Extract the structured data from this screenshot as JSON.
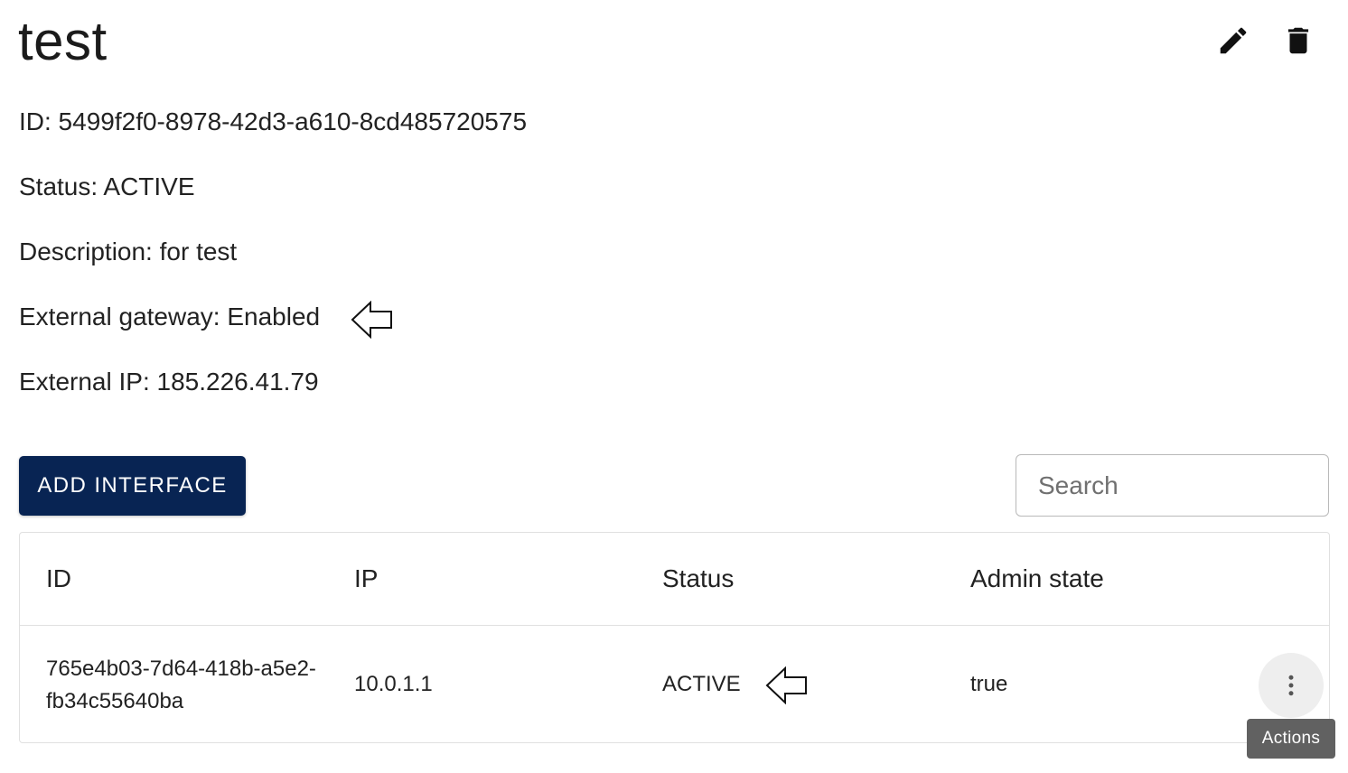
{
  "header": {
    "title": "test"
  },
  "details": {
    "id_line": "ID: 5499f2f0-8978-42d3-a610-8cd485720575",
    "status_line": "Status: ACTIVE",
    "description_line": "Description: for test",
    "external_gateway_line": "External gateway: Enabled",
    "external_ip_line": "External IP: 185.226.41.79"
  },
  "icons": {
    "edit": "pencil-icon",
    "delete": "trash-icon",
    "pointer": "left-arrow-icon",
    "actions": "more-vert-icon"
  },
  "toolbar": {
    "add_interface_label": "ADD INTERFACE",
    "search_placeholder": "Search"
  },
  "table": {
    "columns": [
      "ID",
      "IP",
      "Status",
      "Admin state"
    ],
    "rows": [
      {
        "id": "765e4b03-7d64-418b-a5e2-fb34c55640ba",
        "ip": "10.0.1.1",
        "status": "ACTIVE",
        "admin_state": "true"
      }
    ]
  },
  "tooltip": {
    "actions": "Actions"
  },
  "colors": {
    "primary_button": "#082453",
    "tooltip_bg": "#616161"
  }
}
